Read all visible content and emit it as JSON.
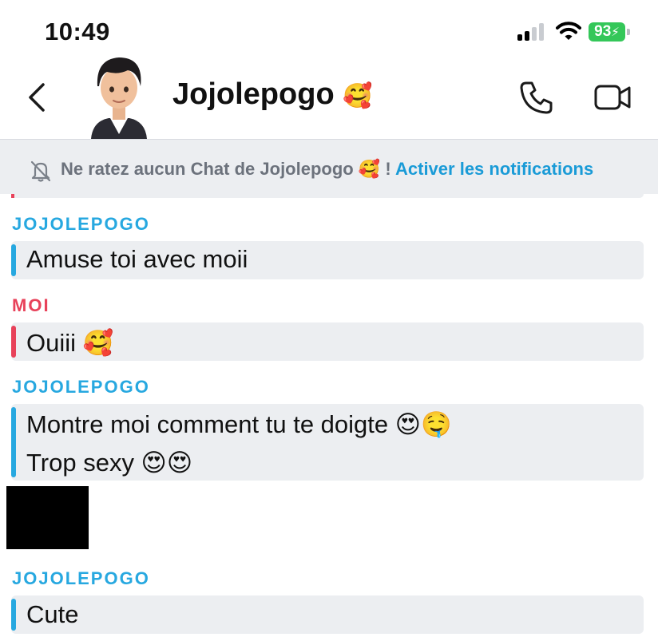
{
  "status_bar": {
    "time": "10:49",
    "battery": "93",
    "signal_bars_active": 2,
    "signal_bars_total": 4,
    "icons": [
      "signal-icon",
      "wifi-icon",
      "battery-charging-icon"
    ]
  },
  "header": {
    "contact_name": "Jojolepogo",
    "contact_emoji": "🥰",
    "icons": [
      "back-chevron-icon",
      "avatar",
      "phone-icon",
      "video-camera-icon"
    ]
  },
  "banner": {
    "text": "Ne ratez aucun Chat de Jojolepogo",
    "emoji": "🥰",
    "separator": " !",
    "link": "Activer les notifications",
    "icon": "bell-muted-icon"
  },
  "messages": [
    {
      "sender": "JOJOLEPOGO",
      "lines": [
        "Amuse toi avec moii"
      ]
    },
    {
      "sender": "MOI",
      "lines": [
        "Ouiii 🥰"
      ]
    },
    {
      "sender": "JOJOLEPOGO",
      "lines": [
        "Montre moi comment tu te doigte 😍🤤",
        "Trop sexy 😍😍"
      ]
    },
    {
      "sender": "JOJOLEPOGO",
      "lines": [
        "Cute"
      ]
    }
  ],
  "colors": {
    "them": "#27a8e0",
    "me": "#e8425a",
    "bubble_bg": "#eceef1",
    "battery": "#34c759",
    "link": "#1a9bd7"
  }
}
